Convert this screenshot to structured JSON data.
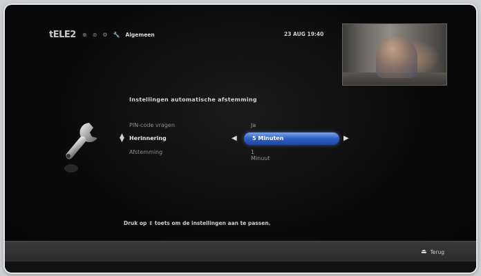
{
  "header": {
    "logo": "tELE2",
    "crumb_icons": [
      "⊕",
      "⊚",
      "⚙"
    ],
    "current_section": "Algemeen",
    "datetime": "23 AUG 19:40"
  },
  "panel": {
    "title": "Instellingen automatische afstemming",
    "rows": [
      {
        "label": "PIN-code vragen",
        "value": "Ja"
      },
      {
        "label": "Herinnering",
        "value": "5 Minuten"
      },
      {
        "label": "Afstemming",
        "value": "1 Minuut"
      }
    ],
    "hint": "Druk op ⇕ toets om de instellingen aan te passen."
  },
  "footer": {
    "back_label": "Terug"
  }
}
